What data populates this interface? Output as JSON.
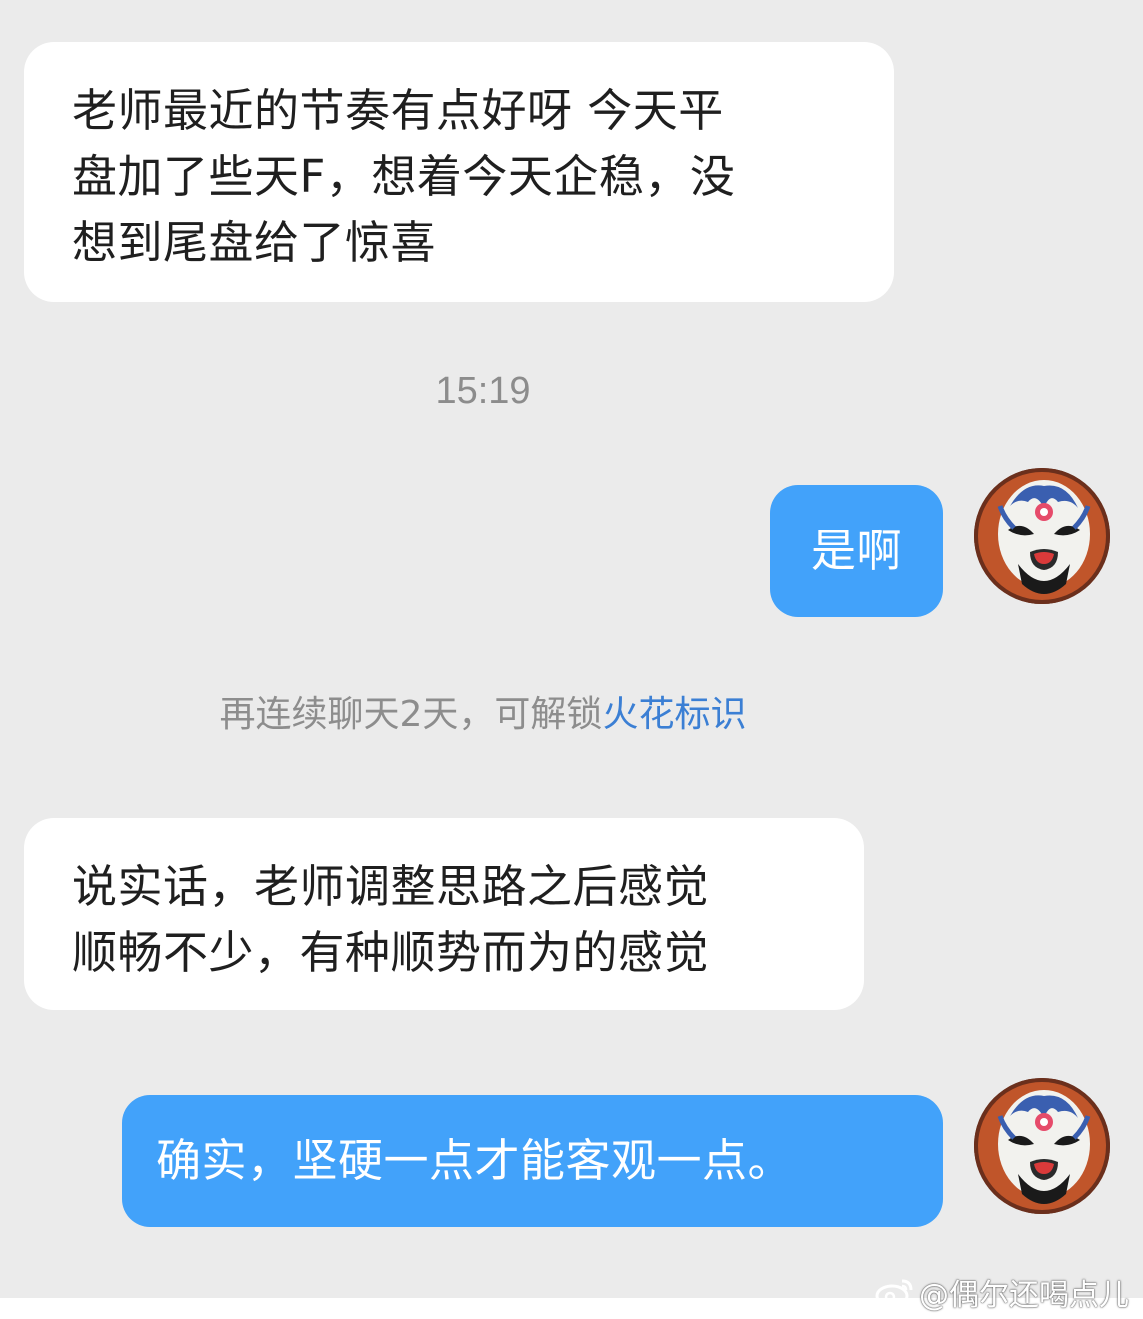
{
  "messages": [
    {
      "side": "incoming",
      "lines": [
        "老师最近的节奏有点好呀 今天平",
        "盘加了些天F，想着今天企稳，没",
        "想到尾盘给了惊喜"
      ]
    },
    {
      "side": "outgoing",
      "text": "是啊"
    },
    {
      "side": "incoming",
      "lines": [
        "说实话，老师调整思路之后感觉",
        "顺畅不少，有种顺势而为的感觉"
      ]
    },
    {
      "side": "outgoing",
      "text": "确实，坚硬一点才能客观一点。"
    }
  ],
  "timestamp": "15:19",
  "notice": {
    "text": "再连续聊天2天，可解锁",
    "link": "火花标识"
  },
  "watermark": "@偶尔还喝点儿",
  "colors": {
    "background": "#ebebeb",
    "outgoing_bubble": "#42a2fa",
    "incoming_bubble": "#ffffff",
    "link": "#3b7fd4"
  },
  "icons": {
    "avatar": "peking-opera-mask-avatar",
    "watermark_logo": "weibo-logo-icon"
  }
}
